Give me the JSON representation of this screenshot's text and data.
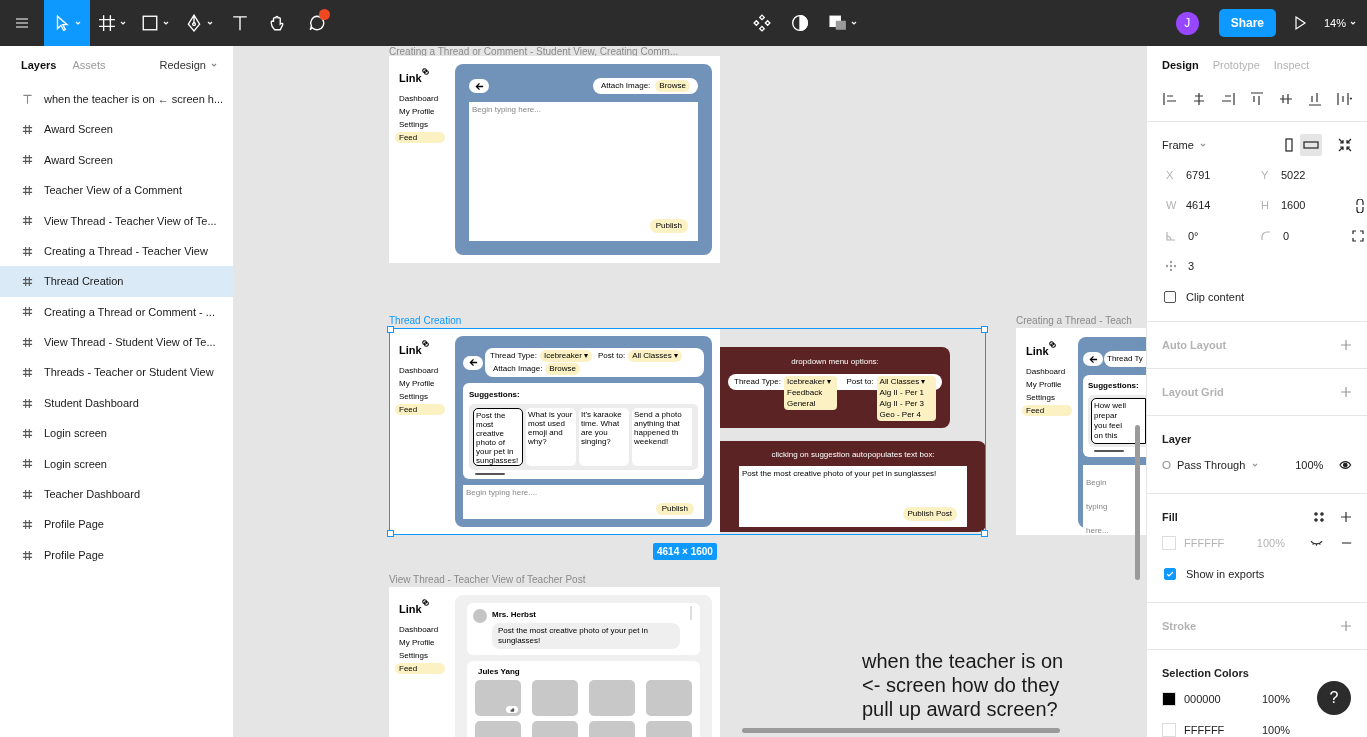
{
  "toolbar": {
    "tools": [
      {
        "kind": "move",
        "selected": true,
        "dropdown": true,
        "notification": false
      },
      {
        "kind": "frame",
        "selected": false,
        "dropdown": true,
        "notification": false
      },
      {
        "kind": "shape",
        "selected": false,
        "dropdown": true,
        "notification": false
      },
      {
        "kind": "pen",
        "selected": false,
        "dropdown": true,
        "notification": false
      },
      {
        "kind": "text",
        "selected": false,
        "dropdown": false,
        "notification": false
      },
      {
        "kind": "hand",
        "selected": false,
        "dropdown": false,
        "notification": false
      },
      {
        "kind": "comment",
        "selected": false,
        "dropdown": false,
        "notification": true
      }
    ],
    "avatar": "J",
    "share": "Share",
    "zoom": "14%"
  },
  "layers_panel": {
    "tabs": [
      {
        "label": "Layers",
        "selected": true
      },
      {
        "label": "Assets",
        "selected": false
      }
    ],
    "page": "Redesign",
    "layers": [
      {
        "kind": "text",
        "name": "when the teacher is on ← screen h...",
        "selected": false
      },
      {
        "kind": "frame",
        "name": "Award Screen",
        "selected": false
      },
      {
        "kind": "frame",
        "name": "Award Screen",
        "selected": false
      },
      {
        "kind": "frame",
        "name": "Teacher View of a Comment",
        "selected": false
      },
      {
        "kind": "frame",
        "name": "View Thread - Teacher View of Te...",
        "selected": false
      },
      {
        "kind": "frame",
        "name": "Creating a Thread - Teacher View",
        "selected": false
      },
      {
        "kind": "frame",
        "name": "Thread Creation",
        "selected": true
      },
      {
        "kind": "frame",
        "name": "Creating a Thread or Comment - ...",
        "selected": false
      },
      {
        "kind": "frame",
        "name": "View Thread - Student View of Te...",
        "selected": false
      },
      {
        "kind": "frame",
        "name": "Threads - Teacher or Student View",
        "selected": false
      },
      {
        "kind": "frame",
        "name": "Student Dashboard",
        "selected": false
      },
      {
        "kind": "frame",
        "name": "Login screen",
        "selected": false
      },
      {
        "kind": "frame",
        "name": "Login screen",
        "selected": false
      },
      {
        "kind": "frame",
        "name": "Teacher Dashboard",
        "selected": false
      },
      {
        "kind": "frame",
        "name": "Profile Page",
        "selected": false
      },
      {
        "kind": "frame",
        "name": "Profile Page",
        "selected": false
      }
    ]
  },
  "canvas": {
    "frames": [
      {
        "kind": "attach",
        "title": "Creating a Thread or Comment - Student View, Creating Comm...",
        "selected": false,
        "logo": "Link",
        "nav": [
          {
            "label": "Dashboard",
            "selected": false
          },
          {
            "label": "My Profile",
            "selected": false
          },
          {
            "label": "Settings",
            "selected": false
          },
          {
            "label": "Feed",
            "selected": true
          }
        ],
        "attach_label": "Attach Image:",
        "browse": "Browse",
        "placeholder": "Begin typing here...",
        "publish": "Publish"
      },
      {
        "kind": "creation",
        "title": "Thread Creation",
        "selected": true,
        "size": "4614 × 1600",
        "logo": "Link",
        "nav": [
          {
            "label": "Dashboard",
            "selected": false
          },
          {
            "label": "My Profile",
            "selected": false
          },
          {
            "label": "Settings",
            "selected": false
          },
          {
            "label": "Feed",
            "selected": true
          }
        ],
        "thread_type_label": "Thread Type:",
        "thread_type": "Icebreaker ▾",
        "post_to_label": "Post to:",
        "post_to": "All Classes ▾",
        "attach_label": "Attach Image:",
        "browse": "Browse",
        "suggestions_title": "Suggestions:",
        "suggestions": [
          {
            "text": "Post the most creative photo of your pet in sunglasses!",
            "selected": true
          },
          {
            "text": "What is your most used emoji and why?",
            "selected": false
          },
          {
            "text": "It's karaoke time. What are you singing?",
            "selected": false
          },
          {
            "text": "Send a photo anything that happened th weekend!",
            "selected": false
          }
        ],
        "placeholder": "Begin typing here....",
        "publish": "Publish",
        "dropdown_note": {
          "title": "dropdown menu options:",
          "thread_type_label": "Thread Type:",
          "thread_type_options": [
            "Icebreaker ▾",
            "Feedback",
            "General"
          ],
          "post_to_label": "Post to:",
          "post_to_options": [
            "All Classes ▾",
            "Alg II - Per 1",
            "Alg II - Per 3",
            "Geo - Per 4"
          ]
        },
        "autofill_note": {
          "title": "clicking on suggestion autopopulates text box:",
          "text": "Post the most creative photo of your pet in sunglasses!",
          "button": "Publish Post"
        }
      },
      {
        "kind": "partial",
        "title": "Creating a Thread - Teach",
        "selected": false,
        "logo": "Link",
        "nav": [
          {
            "label": "Dashboard",
            "selected": false
          },
          {
            "label": "My Profile",
            "selected": false
          },
          {
            "label": "Settings",
            "selected": false
          },
          {
            "label": "Feed",
            "selected": true
          }
        ],
        "thread_type_label": "Thread Ty",
        "suggestions_title": "Suggestions:",
        "suggestion": "How well prepar you feel on this",
        "placeholder": "Begin typing here..."
      },
      {
        "kind": "view",
        "title": "View Thread - Teacher View of Teacher Post",
        "selected": false,
        "logo": "Link",
        "nav": [
          {
            "label": "Dashboard",
            "selected": false
          },
          {
            "label": "My Profile",
            "selected": false
          },
          {
            "label": "Settings",
            "selected": false
          },
          {
            "label": "Feed",
            "selected": true
          }
        ],
        "author": "Mrs. Herbst",
        "post": "Post the most creative photo of your pet in sunglasses!",
        "reply_author": "Jules Yang"
      }
    ],
    "note": "when the teacher is on\n<- screen how do they\npull up award screen?"
  },
  "design_panel": {
    "tabs": [
      {
        "label": "Design",
        "selected": true
      },
      {
        "label": "Prototype",
        "selected": false
      },
      {
        "label": "Inspect",
        "selected": false
      }
    ],
    "frame_label": "Frame",
    "orientation": [
      {
        "kind": "portrait",
        "selected": false
      },
      {
        "kind": "landscape",
        "selected": true
      }
    ],
    "fields": [
      {
        "kind": "label",
        "label": "X",
        "value": "6791"
      },
      {
        "kind": "label",
        "label": "Y",
        "value": "5022"
      },
      {
        "kind": "label",
        "label": "W",
        "value": "4614"
      },
      {
        "kind": "label",
        "label": "H",
        "value": "1600"
      },
      {
        "kind": "rotation",
        "value": "0°"
      },
      {
        "kind": "radius",
        "value": "0"
      },
      {
        "kind": "smoothing",
        "value": "3"
      }
    ],
    "clip": {
      "label": "Clip content",
      "checked": false
    },
    "sections": [
      {
        "kind": "empty",
        "title": "Auto Layout"
      },
      {
        "kind": "empty",
        "title": "Layout Grid"
      },
      {
        "kind": "layer",
        "title": "Layer",
        "blend": "Pass Through",
        "opacity": "100%",
        "visible": true
      },
      {
        "kind": "fill",
        "title": "Fill",
        "fills": [
          {
            "color": "#ffffff",
            "hex": "FFFFFF",
            "opacity": "100%",
            "visible": false
          }
        ],
        "export": {
          "label": "Show in exports",
          "checked": true
        }
      },
      {
        "kind": "empty",
        "title": "Stroke"
      },
      {
        "kind": "colors",
        "title": "Selection Colors",
        "colors": [
          {
            "color": "#000000",
            "hex": "000000",
            "opacity": "100%"
          },
          {
            "color": "#ffffff",
            "hex": "FFFFFF",
            "opacity": "100%"
          }
        ]
      }
    ]
  },
  "help": "?"
}
